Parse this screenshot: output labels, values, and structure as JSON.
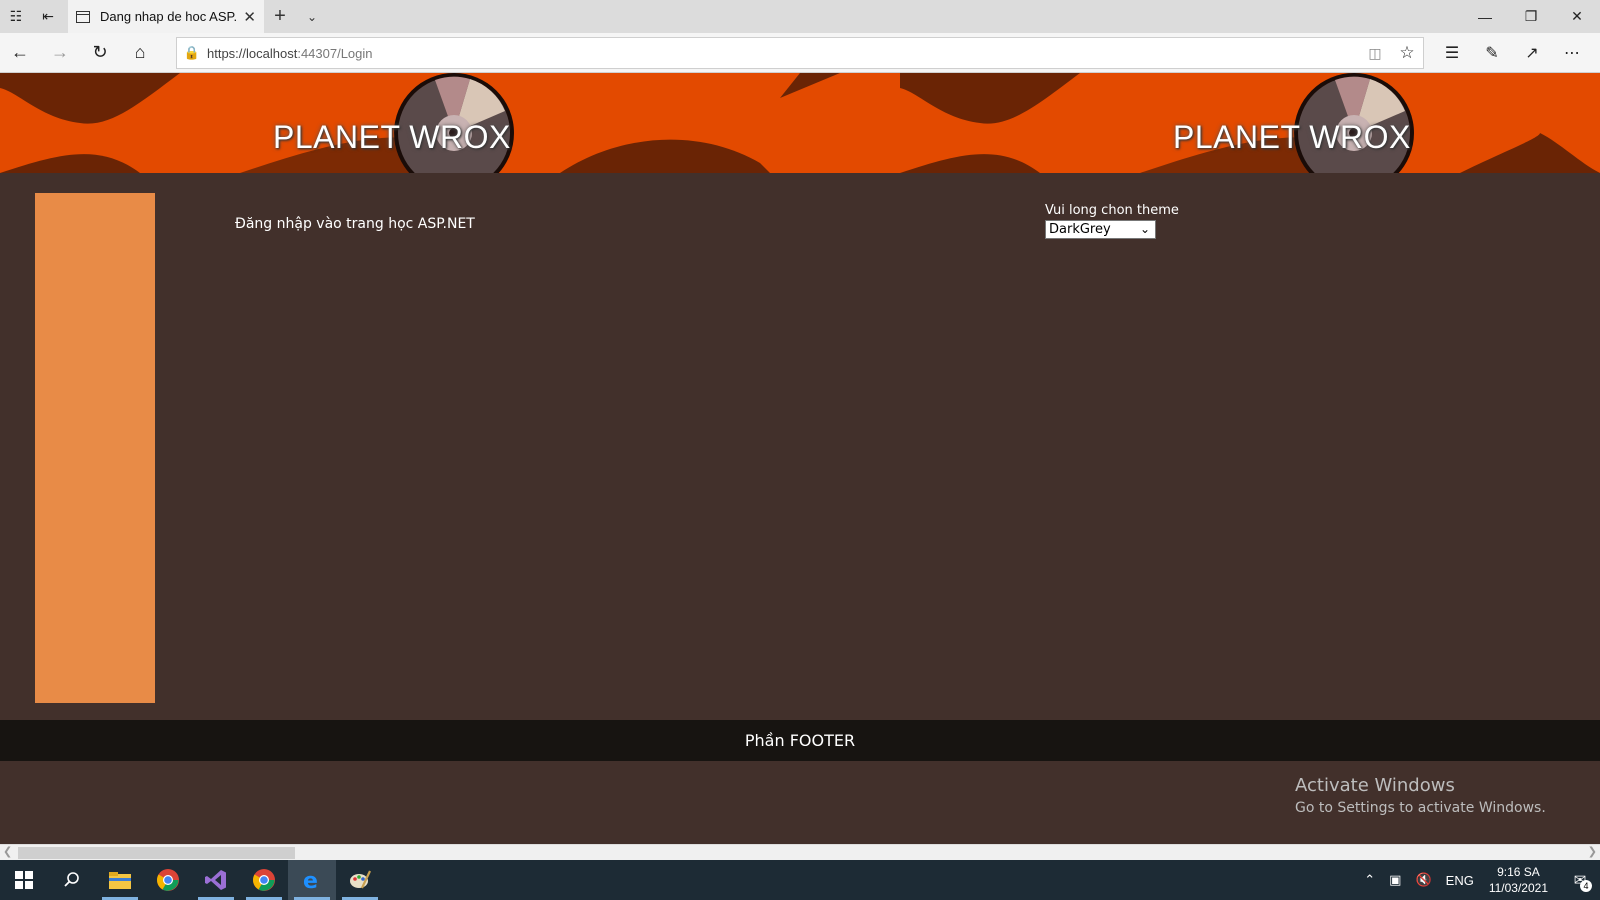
{
  "browser": {
    "tab_title": "Dang nhap de hoc ASP.",
    "url_host": "https://localhost",
    "url_rest": ":44307/Login"
  },
  "banner": {
    "brand_left": "PLANET WROX",
    "brand_right": "PLANET WROX",
    "colors": {
      "background": "#e34a00",
      "swoosh": "#6a2405"
    }
  },
  "main": {
    "title": "Đăng nhập vào trang học ASP.NET"
  },
  "theme": {
    "label": "Vui long chon theme",
    "selected": "DarkGrey"
  },
  "footer": {
    "text": "Phần FOOTER"
  },
  "watermark": {
    "line1": "Activate Windows",
    "line2": "Go to Settings to activate Windows."
  },
  "taskbar": {
    "language": "ENG",
    "time": "9:16 SA",
    "date": "11/03/2021",
    "notification_count": "4",
    "apps": [
      "file-explorer-icon",
      "chrome-icon",
      "visual-studio-icon",
      "chrome-icon",
      "edge-icon",
      "paint-icon"
    ]
  },
  "colors": {
    "page_background": "#42302b",
    "sidebar": "#e88b47",
    "footer_background": "#171411"
  }
}
